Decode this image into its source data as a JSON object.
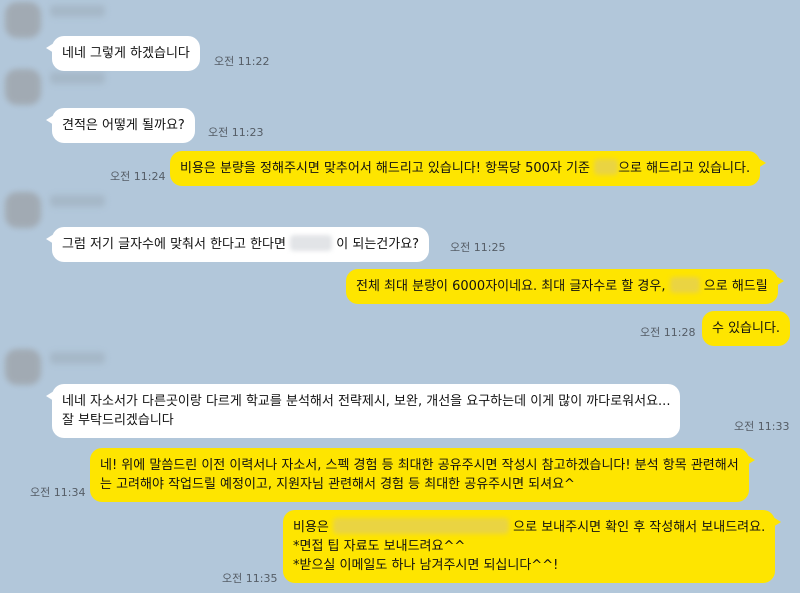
{
  "messages": [
    {
      "text": "네네 그렇게 하겠습니다",
      "time": "오전 11:22"
    },
    {
      "text": "견적은 어떻게 될까요?",
      "time": "오전 11:23"
    },
    {
      "text_before": "비용은 분량을 정해주시면 맞추어서 해드리고 있습니다! 항목당 500자 기준",
      "text_after": "으로 해드리고 있습니다.",
      "time": "오전 11:24"
    },
    {
      "text_before": "그럼 저기 글자수에 맞춰서 한다고 한다면",
      "text_after": "이 되는건가요?",
      "time": "오전 11:25"
    },
    {
      "text_before": "전체 최대 분량이 6000자이네요. 최대 글자수로 할 경우,",
      "text_after": "으로 해드릴"
    },
    {
      "text": "수 있습니다.",
      "time": "오전 11:28"
    },
    {
      "line1": "네네 자소서가 다른곳이랑 다르게 학교를 분석해서 전략제시, 보완, 개선을 요구하는데 이게 많이 까다로워서요...",
      "line2": "잘 부탁드리겠습니다",
      "time": "오전 11:33"
    },
    {
      "line1": "네! 위에 말씀드린 이전 이력서나 자소서, 스펙 경험 등 최대한 공유주시면 작성시 참고하겠습니다! 분석 항목 관련해서",
      "line2": "는 고려해야 작업드릴 예정이고, 지원자님 관련해서 경험 등 최대한 공유주시면 되셔요^",
      "time": "오전 11:34"
    },
    {
      "line1_before": "비용은",
      "line1_after": "으로 보내주시면 확인 후 작성해서 보내드려요.",
      "line2": "*면접 팁 자료도 보내드려요^^",
      "line3": "*받으실 이메일도 하나 남겨주시면 되십니다^^!",
      "time": "오전 11:35"
    }
  ]
}
